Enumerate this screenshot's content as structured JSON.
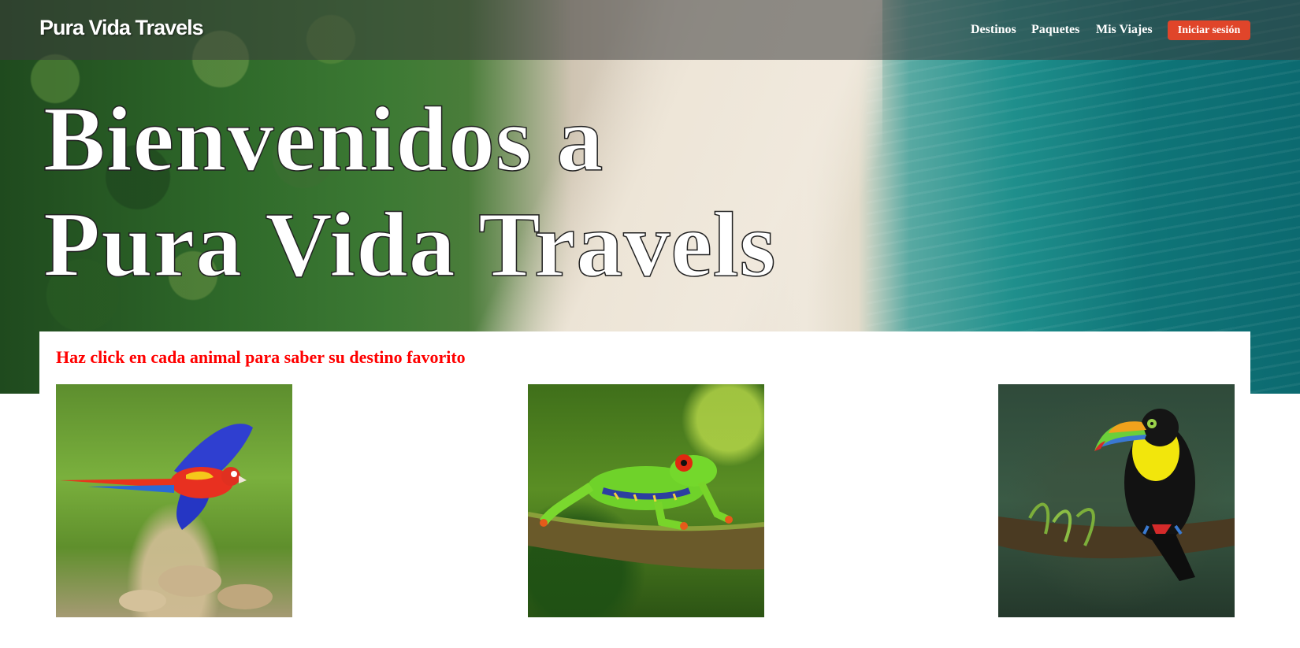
{
  "nav": {
    "brand": "Pura Vida Travels",
    "links": [
      "Destinos",
      "Paquetes",
      "Mis Viajes"
    ],
    "login_label": "Iniciar sesión"
  },
  "hero": {
    "title_line1": "Bienvenidos a",
    "title_line2": "Pura Vida Travels"
  },
  "card": {
    "heading": "Haz click en cada animal para saber su destino favorito",
    "animals": [
      "scarlet-macaw",
      "red-eyed-tree-frog",
      "keel-billed-toucan"
    ]
  },
  "colors": {
    "login_button": "#e0452a",
    "heading_red": "#ff0000"
  }
}
